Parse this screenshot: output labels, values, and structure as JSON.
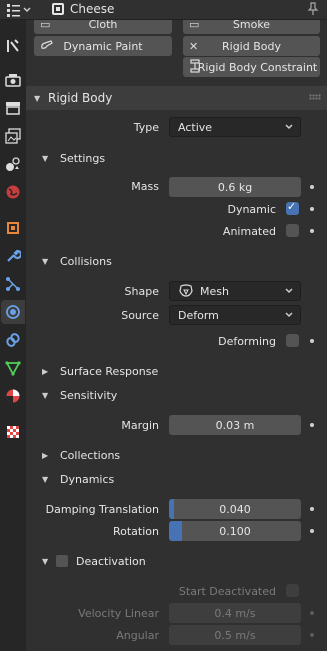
{
  "header": {
    "object_name": "Cheese"
  },
  "physics_buttons": {
    "cloth": "Cloth",
    "smoke": "Smoke",
    "dynamic_paint": "Dynamic Paint",
    "rigid_body": "Rigid Body",
    "rigid_body_constraint": "Rigid Body Constraint"
  },
  "rigid_body": {
    "title": "Rigid Body",
    "type_label": "Type",
    "type_value": "Active",
    "settings": {
      "title": "Settings",
      "mass_label": "Mass",
      "mass_value": "0.6 kg",
      "dynamic_label": "Dynamic",
      "dynamic_checked": true,
      "animated_label": "Animated",
      "animated_checked": false
    },
    "collisions": {
      "title": "Collisions",
      "shape_label": "Shape",
      "shape_value": "Mesh",
      "source_label": "Source",
      "source_value": "Deform",
      "deforming_label": "Deforming",
      "deforming_checked": false
    },
    "surface_response": {
      "title": "Surface Response"
    },
    "sensitivity": {
      "title": "Sensitivity",
      "margin_label": "Margin",
      "margin_value": "0.03 m"
    },
    "collections": {
      "title": "Collections"
    },
    "dynamics": {
      "title": "Dynamics",
      "damping_translation_label": "Damping Translation",
      "damping_translation_value": "0.040",
      "damping_translation_fraction": 0.04,
      "rotation_label": "Rotation",
      "rotation_value": "0.100",
      "rotation_fraction": 0.1
    },
    "deactivation": {
      "title": "Deactivation",
      "enabled": false,
      "start_deactivated_label": "Start Deactivated",
      "velocity_linear_label": "Velocity Linear",
      "velocity_linear_value": "0.4 m/s",
      "angular_label": "Angular",
      "angular_value": "0.5 m/s"
    }
  },
  "colors": {
    "accent": "#4772b3",
    "panel": "#303030",
    "field": "#545454"
  }
}
